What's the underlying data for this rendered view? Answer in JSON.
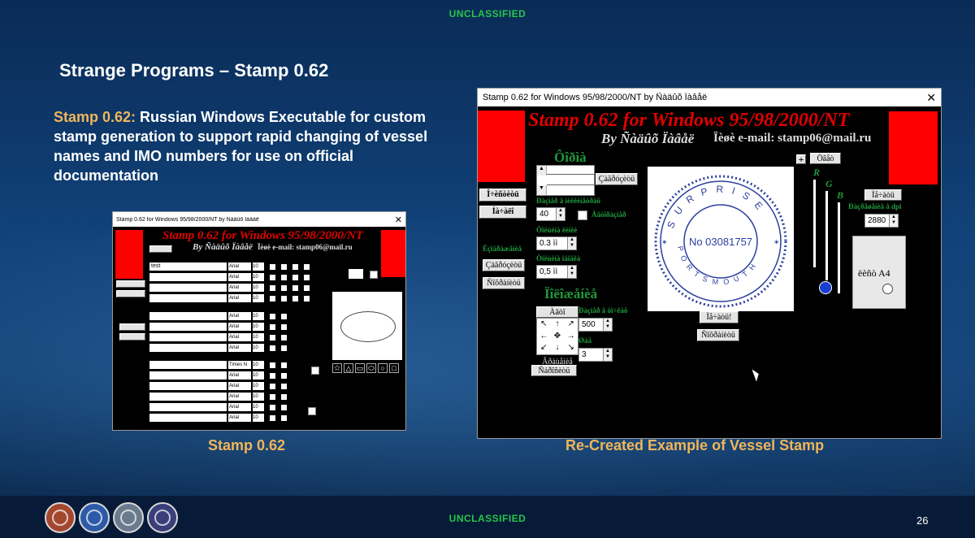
{
  "slide": {
    "classification_top": "UNCLASSIFIED",
    "classification_bottom": "UNCLASSIFIED",
    "title": "Strange Programs – Stamp 0.62",
    "desc_highlight": "Stamp 0.62:",
    "desc_text": " Russian Windows Executable for custom stamp generation to support rapid changing of vessel names and IMO numbers for use on official documentation",
    "caption_left": "Stamp 0.62",
    "caption_right": "Re-Created Example of Vessel Stamp",
    "page_number": "26",
    "seal_icons": [
      "seal-icon-1",
      "seal-icon-2",
      "seal-icon-3",
      "seal-icon-4"
    ]
  },
  "small_window": {
    "title": "Stamp 0.62 for Windows 95/98/2000/NT by Ñàäûõ Ïàâåë",
    "header": "Stamp 0.62 for Windows 95/98/2000/NT",
    "byline": "By Ñàäûõ Ïàâåë",
    "email": "Ïèøè e-mail: stamp06@mail.ru",
    "first_text_value": "test",
    "font_arial": "Arial",
    "font_times": "Times N",
    "size_value": "10"
  },
  "main_window": {
    "title": "Stamp 0.62 for Windows 95/98/2000/NT by Ñàäûõ Ïàâåë",
    "header": "Stamp 0.62 for Windows 95/98/2000/NT",
    "byline": "By Ñàäûõ Ïàâåë",
    "email": "Ïèøè e-mail: stamp06@mail.ru",
    "section_form": "Ôîðìà",
    "btn_left_1": "Î÷èñòèòü",
    "btn_left_2": "Íà÷àëî",
    "label_left_small": "Èçîáðàæåíèå",
    "btn_left_3": "Çàãðóçèòü",
    "btn_left_4": "Ñîõðàíèòü",
    "btn_load": "Çàãðóçèòü",
    "label_size": "Ðàçìåð â ìèëëèìåòðàõ",
    "size_value": "40",
    "auto_label": "Àâòîðàçìåð",
    "label_thick1": "Òîëùèíà ëèíèé",
    "thick1_value": "0.3 ìì",
    "label_thick2": "Òîëùèíà îáîäêà",
    "thick2_value": "0,5 ìì",
    "section_position": "Ïîëîæåíèå",
    "btn_center": "Àâòî",
    "label_count": "Ðàçìåð â òî÷êàõ",
    "count_value": "500",
    "label_step": "Øàã",
    "step_value": "3",
    "label_rotate": "Âðàùåíèå",
    "btn_reset": "Ñáðîñèòü",
    "stamp_top_text": "SURPRISE",
    "stamp_bottom_text": "PORTSMOUTH",
    "stamp_number": "No 03081757",
    "btn_print": "Ïå÷àòü!",
    "btn_save": "Ñîõðàíèòü",
    "btn_color": "Öâåò",
    "rgb_r": "R",
    "rgb_g": "G",
    "rgb_b": "B",
    "btn_print_setup": "Ïå÷àòü",
    "label_dpi": "Ðàçðåøåíèå â dpi",
    "dpi_value": "2880",
    "paper_label": "ëèñò A4",
    "colors": {
      "red": "#ff0000",
      "green": "#1f9a3a",
      "stamp_blue": "#2a3f9e",
      "slider_blue": "#1a3fd0"
    }
  }
}
